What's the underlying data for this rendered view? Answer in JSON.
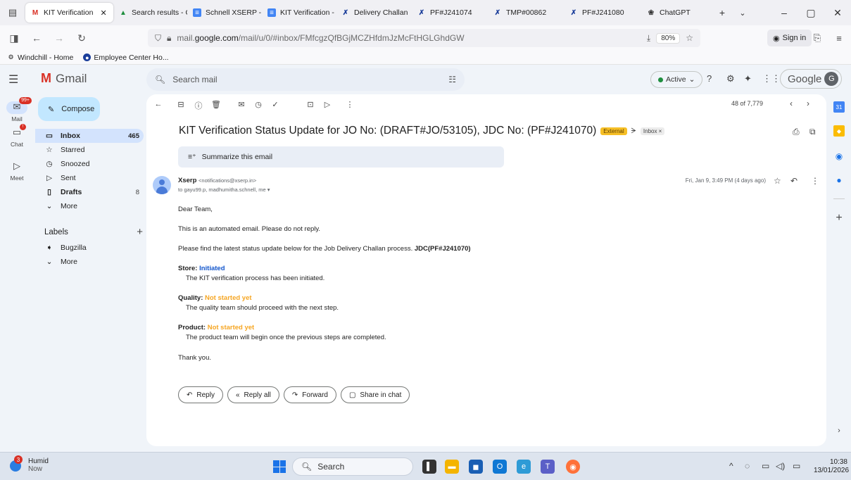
{
  "browser": {
    "tabs": [
      {
        "icon": "gmail-icon",
        "label": "KIT Verification"
      },
      {
        "icon": "drive-icon",
        "label": "Search results - G"
      },
      {
        "icon": "doc-icon",
        "label": "Schnell XSERP - K"
      },
      {
        "icon": "doc-icon",
        "label": "KIT Verification - |"
      },
      {
        "icon": "xserp-icon",
        "label": "Delivery Challan"
      },
      {
        "icon": "xserp-icon",
        "label": "PF#J241074"
      },
      {
        "icon": "xserp-icon",
        "label": "TMP#00862"
      },
      {
        "icon": "xserp-icon",
        "label": "PF#J241080"
      },
      {
        "icon": "chatgpt-icon",
        "label": "ChatGPT"
      }
    ],
    "url_prefix": "mail.",
    "url_domain": "google.com",
    "url_path": "/mail/u/0/#inbox/FMfcgzQfBGjMCZHfdmJzMcFtHGLGhdGW",
    "zoom": "80%",
    "signin_label": "Sign in",
    "bookmarks": [
      {
        "label": "Windchill - Home"
      },
      {
        "label": "Employee Center Ho..."
      }
    ]
  },
  "gmail": {
    "logo_text": "Gmail",
    "search_placeholder": "Search mail",
    "status_label": "Active",
    "account_label": "Google",
    "account_initial": "G"
  },
  "rail": {
    "mail_label": "Mail",
    "mail_badge": "99+",
    "chat_label": "Chat",
    "meet_label": "Meet"
  },
  "leftnav": {
    "compose_label": "Compose",
    "items": [
      {
        "label": "Inbox",
        "count": "465"
      },
      {
        "label": "Starred",
        "count": ""
      },
      {
        "label": "Snoozed",
        "count": ""
      },
      {
        "label": "Sent",
        "count": ""
      },
      {
        "label": "Drafts",
        "count": "8"
      },
      {
        "label": "More",
        "count": ""
      }
    ],
    "labels_title": "Labels",
    "labels": [
      {
        "label": "Bugzilla"
      },
      {
        "label": "More"
      }
    ]
  },
  "message": {
    "pager_text": "48 of 7,779",
    "subject": "KIT Verification Status Update for JO No: (DRAFT#JO/53105), JDC No: (PF#J241070)",
    "external_badge": "External",
    "inbox_chip": "Inbox ×",
    "summarize_label": "Summarize this email",
    "sender_name": "Xserp",
    "sender_email": "<notifications@xserp.in>",
    "to_line": "to gayu99.p, madhumitha.schnell, me",
    "date": "Fri, Jan 9, 3:49 PM (4 days ago)",
    "greeting": "Dear Team,",
    "line1": "This is an automated email. Please do not reply.",
    "line2": "Please find the latest status update below for the Job Delivery Challan process.",
    "line2_bold": "JDC(PF#J241070)",
    "store_label": "Store:",
    "store_status": "Initiated",
    "store_desc": "The KIT verification process has been initiated.",
    "quality_label": "Quality:",
    "quality_status": "Not started yet",
    "quality_desc": "The quality team should proceed with the next step.",
    "product_label": "Product:",
    "product_status": "Not started yet",
    "product_desc": "The product team will begin once the previous steps are completed.",
    "closing": "Thank you.",
    "actions": {
      "reply": "Reply",
      "reply_all": "Reply all",
      "forward": "Forward",
      "share": "Share in chat"
    }
  },
  "taskbar": {
    "weather_title": "Humid",
    "weather_sub": "Now",
    "weather_badge": "3",
    "search_placeholder": "Search",
    "time": "10:38",
    "date": "13/01/2026"
  },
  "colors": {
    "status_initiated": "#1155cc",
    "status_not_started": "#f6a623",
    "compose_bg": "#c2e7ff",
    "selected_nav": "#d3e3fd",
    "external_badge": "#f6bf26"
  }
}
